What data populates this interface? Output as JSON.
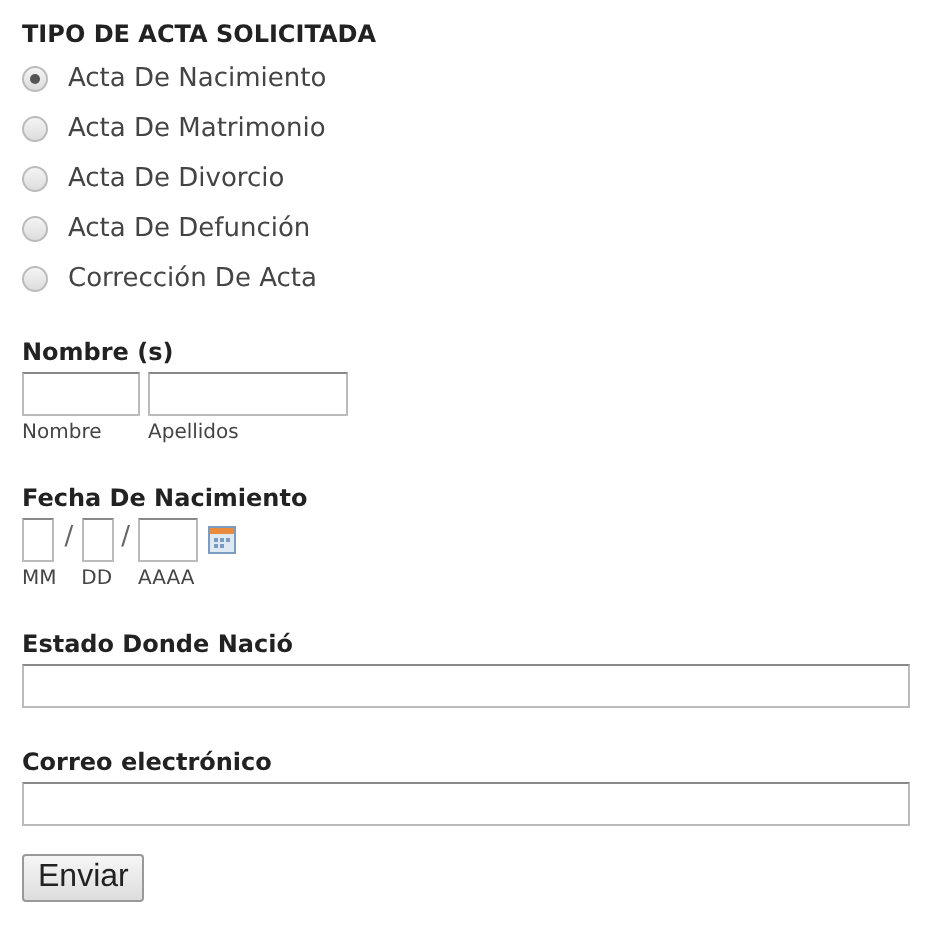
{
  "title": "TIPO DE ACTA SOLICITADA",
  "options": [
    {
      "label": "Acta De Nacimiento",
      "selected": true
    },
    {
      "label": "Acta De Matrimonio",
      "selected": false
    },
    {
      "label": "Acta De Divorcio",
      "selected": false
    },
    {
      "label": "Acta De Defunción",
      "selected": false
    },
    {
      "label": "Corrección De Acta",
      "selected": false
    }
  ],
  "name": {
    "label": "Nombre (s)",
    "fields": [
      {
        "sublabel": "Nombre"
      },
      {
        "sublabel": "Apellidos"
      }
    ]
  },
  "birth_date": {
    "label": "Fecha De Nacimiento",
    "separator": "/",
    "fields": [
      {
        "sublabel": "MM"
      },
      {
        "sublabel": "DD"
      },
      {
        "sublabel": "AAAA"
      }
    ]
  },
  "birth_state": {
    "label": "Estado Donde Nació"
  },
  "email": {
    "label": "Correo electrónico"
  },
  "submit": "Enviar"
}
